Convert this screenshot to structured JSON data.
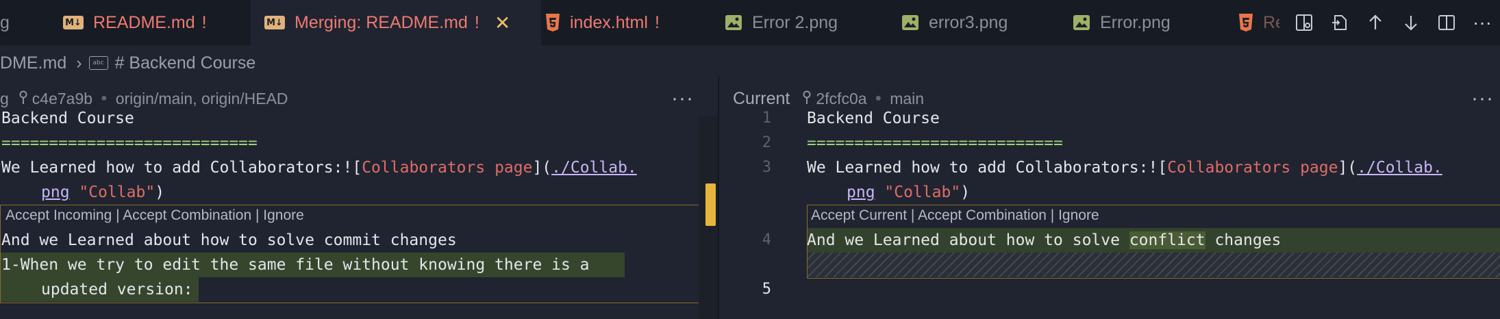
{
  "tabs": [
    {
      "label": "README.md",
      "mark": "!"
    },
    {
      "label": "Merging: README.md",
      "mark": "!"
    },
    {
      "label": "index.html",
      "mark": "!"
    },
    {
      "label": "Error 2.png"
    },
    {
      "label": "error3.png"
    },
    {
      "label": "Error.png"
    },
    {
      "label": "Rea"
    }
  ],
  "tab_partial_left": "g",
  "breadcrumb": {
    "file": "DME.md",
    "section": "# Backend Course",
    "abc": "abc"
  },
  "left_pane": {
    "header_partial": "g",
    "commit": "c4e7a9b",
    "branches": "origin/main, origin/HEAD",
    "more": "···",
    "lines": {
      "l1": "Backend Course",
      "l2": "===========================",
      "l3a": "We Learned how to add Collaborators:![",
      "l3b": "Collaborators page",
      "l3c": "](",
      "l3d": "./Collab.",
      "l3e": "png",
      "l3f": "\"Collab\"",
      "l3g": ")",
      "codelens": "Accept Incoming | Accept Combination | Ignore",
      "l4": "And we Learned about how to solve commit changes",
      "l5a": "1-When we try to edit the same file without knowing there is a",
      "l5b": "updated version:"
    }
  },
  "right_pane": {
    "title": "Current",
    "commit": "2fcfc0a",
    "branch": "main",
    "more": "···",
    "line_numbers": [
      "1",
      "2",
      "3",
      "4",
      "5"
    ],
    "lines": {
      "l1": "Backend Course",
      "l2": "===========================",
      "l3a": "We Learned how to add Collaborators:![",
      "l3b": "Collaborators page",
      "l3c": "](",
      "l3d": "./Collab.",
      "l3e": "png",
      "l3f": "\"Collab\"",
      "l3g": ")",
      "codelens": "Accept Current | Accept Combination | Ignore",
      "l4a": "And we Learned about how to solve ",
      "l4b": "conflict",
      "l4c": " changes"
    }
  },
  "icons": [
    "markdown-icon",
    "html5-icon",
    "image-icon",
    "close-icon",
    "split-editor-icon",
    "open-file-icon",
    "arrow-up-icon",
    "arrow-down-icon",
    "toggle-layout-icon",
    "more-actions-icon",
    "commit-icon",
    "abc-symbol-icon"
  ],
  "colors": {
    "modified": "#ee7a70",
    "conflict_border": "#8a6d2b",
    "incoming_bg": "#36462d",
    "scroll_marker": "#e6b53c"
  }
}
